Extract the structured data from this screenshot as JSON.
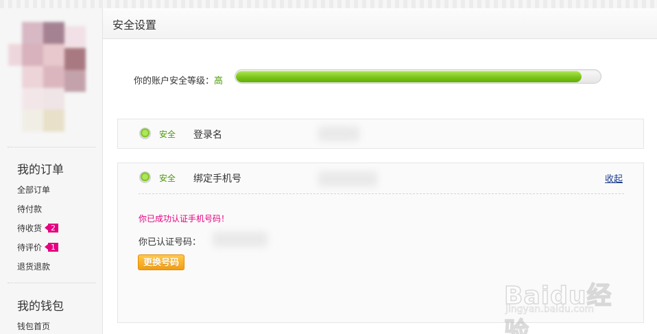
{
  "header": {
    "title": "安全设置"
  },
  "sidebar": {
    "sections": [
      {
        "title": "我的订单",
        "items": [
          {
            "label": "全部订单",
            "badge": ""
          },
          {
            "label": "待付款",
            "badge": ""
          },
          {
            "label": "待收货",
            "badge": "2"
          },
          {
            "label": "待评价",
            "badge": "1"
          },
          {
            "label": "退货退款",
            "badge": ""
          }
        ]
      },
      {
        "title": "我的钱包",
        "items": [
          {
            "label": "钱包首页",
            "badge": ""
          }
        ]
      }
    ]
  },
  "security": {
    "level_label": "你的账户安全等级：",
    "level_value": "高",
    "level_percent": 95,
    "rows": [
      {
        "status": "安全",
        "label": "登录名"
      },
      {
        "status": "安全",
        "label": "绑定手机号",
        "toggle_label": "收起",
        "success_message": "你已成功认证手机号码！",
        "verified_label": "你已认证号码：",
        "change_button": "更换号码"
      }
    ]
  },
  "watermark": {
    "brand": "Baidu经验",
    "url": "jingyan.baidu.com"
  },
  "colors": {
    "accent_green": "#7cc51a",
    "success_pink": "#e5007f",
    "button_orange": "#f49d0f",
    "link_blue": "#1a3d8f"
  }
}
